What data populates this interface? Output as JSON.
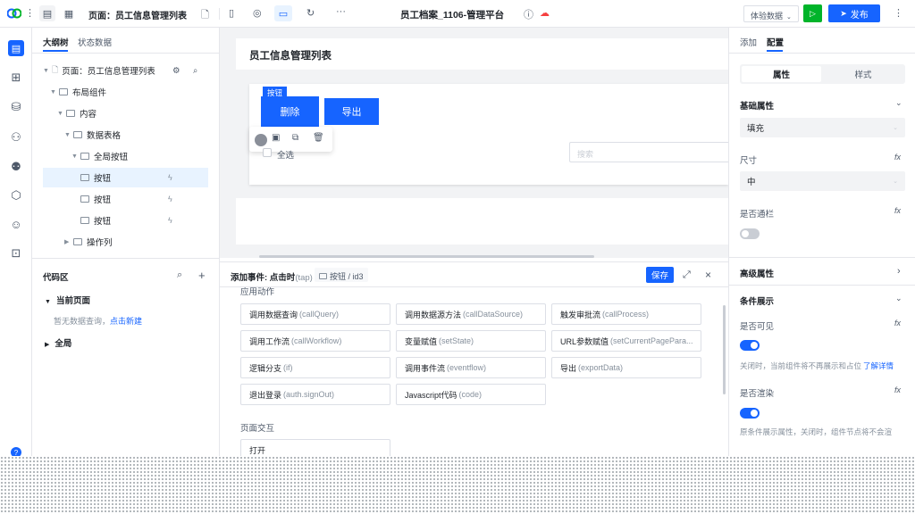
{
  "topbar": {
    "page_label": "页面：员工信息管理列表",
    "app_title": "员工档案_1106-管理平台",
    "env_select": "体验数据",
    "publish_label": "发布",
    "more": "···"
  },
  "outline": {
    "tabs": [
      "大纲树",
      "状态数据"
    ],
    "tree": [
      {
        "label": "页面：员工信息管理列表"
      },
      {
        "label": "布局组件"
      },
      {
        "label": "内容"
      },
      {
        "label": "数据表格"
      },
      {
        "label": "全局按钮"
      },
      {
        "label": "按钮"
      },
      {
        "label": "按钮"
      },
      {
        "label": "按钮"
      },
      {
        "label": "操作列"
      }
    ],
    "code_title": "代码区",
    "current_page": "当前页面",
    "empty_hint": "暂无数据查询，",
    "create_link": "点击新建",
    "global": "全局"
  },
  "canvas": {
    "title": "员工信息管理列表",
    "selected_tag": "按钮",
    "delete_label": "删除",
    "export_label": "导出",
    "select_all": "全选",
    "search_placeholder": "搜索"
  },
  "event_panel": {
    "title": "添加事件: 点击时",
    "title_sub": "(tap)",
    "target": "按钮 / id3",
    "save_label": "保存",
    "section_app": "应用动作",
    "actions": [
      {
        "name": "调用数据查询",
        "api": "(callQuery)"
      },
      {
        "name": "调用数据源方法",
        "api": "(callDataSource)"
      },
      {
        "name": "触发审批流",
        "api": "(callProcess)"
      },
      {
        "name": "调用工作流",
        "api": "(callWorkflow)"
      },
      {
        "name": "变量赋值",
        "api": "(setState)"
      },
      {
        "name": "URL参数赋值",
        "api": "(setCurrentPagePara..."
      },
      {
        "name": "逻辑分支",
        "api": "(if)"
      },
      {
        "name": "调用事件流",
        "api": "(eventflow)"
      },
      {
        "name": "导出",
        "api": "(exportData)"
      },
      {
        "name": "退出登录",
        "api": "(auth.signOut)"
      },
      {
        "name": "Javascript代码",
        "api": "(code)"
      }
    ],
    "section_page": "页面交互",
    "partial_action": "打开"
  },
  "right_panel": {
    "tabs": [
      "添加",
      "配置"
    ],
    "seg": [
      "属性",
      "样式"
    ],
    "basic_title": "基础属性",
    "fill_value": "填充",
    "size_label": "尺寸",
    "size_value": "中",
    "block_label": "是否通栏",
    "advanced_title": "高级属性",
    "condition_title": "条件展示",
    "visible_label": "是否可见",
    "visible_hint": "关闭时，当前组件将不再展示和占位",
    "learn_more": "了解详情",
    "render_label": "是否渲染",
    "render_hint": "原条件展示属性，关闭时，组件节点将不会渲",
    "fx": "fx"
  },
  "colors": {
    "primary": "#1664ff",
    "run_green": "#00b42a"
  }
}
